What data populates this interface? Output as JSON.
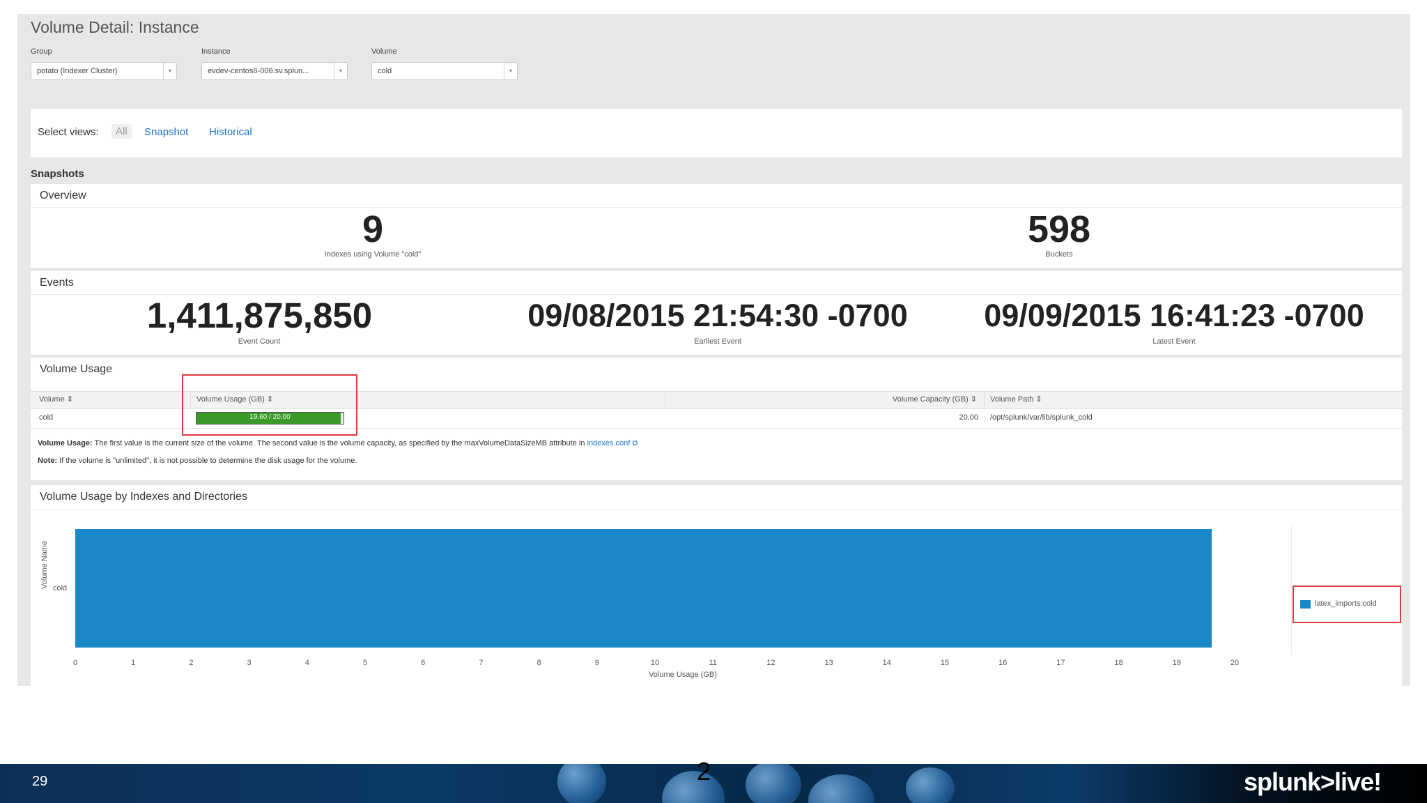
{
  "title": "Volume Detail: Instance",
  "filters": {
    "group": {
      "label": "Group",
      "value": "potato (Indexer Cluster)"
    },
    "instance": {
      "label": "Instance",
      "value": "evdev-centos6-006.sv.splun..."
    },
    "volume": {
      "label": "Volume",
      "value": "cold"
    }
  },
  "views": {
    "label": "Select views:",
    "all": "All",
    "snapshot": "Snapshot",
    "historical": "Historical"
  },
  "snapshots_heading": "Snapshots",
  "overview": {
    "title": "Overview",
    "indexes_value": "9",
    "indexes_label": "Indexes using Volume \"cold\"",
    "buckets_value": "598",
    "buckets_label": "Buckets"
  },
  "events": {
    "title": "Events",
    "count_value": "1,411,875,850",
    "count_label": "Event Count",
    "earliest_value": "09/08/2015 21:54:30 -0700",
    "earliest_label": "Earliest Event",
    "latest_value": "09/09/2015 16:41:23 -0700",
    "latest_label": "Latest Event"
  },
  "volume_usage": {
    "title": "Volume Usage",
    "columns": [
      "Volume",
      "Volume Usage (GB)",
      "Volume Capacity (GB)",
      "Volume Path"
    ],
    "row": {
      "volume": "cold",
      "usage_text": "19.60 / 20.00",
      "usage_fraction": 0.98,
      "capacity": "20.00",
      "path": "/opt/splunk/var/lib/splunk_cold"
    },
    "note1_bold": "Volume Usage:",
    "note1_text": "The first value is the current size of the volume. The second value is the volume capacity, as specified by the maxVolumeDataSizeMB attribute in",
    "note1_link": "indexes.conf",
    "note2_bold": "Note:",
    "note2_text": "If the volume is \"unlimited\", it is not possible to determine the disk usage for the volume."
  },
  "colors": {
    "bar": "#1a87c7",
    "usage_green": "#3b9b2a",
    "highlight": "#e0393e"
  },
  "chart_data": {
    "type": "bar",
    "orientation": "horizontal",
    "title": "Volume Usage by Indexes and Directories",
    "categories": [
      "cold"
    ],
    "series": [
      {
        "name": "latex_imports:cold",
        "values": [
          19.6
        ]
      }
    ],
    "xlabel": "Volume Usage (GB)",
    "ylabel": "Volume Name",
    "xlim": [
      0,
      20
    ],
    "xticks": [
      "0",
      "1",
      "2",
      "3",
      "4",
      "5",
      "6",
      "7",
      "8",
      "9",
      "10",
      "11",
      "12",
      "13",
      "14",
      "15",
      "16",
      "17",
      "18",
      "19",
      "20"
    ],
    "legend_position": "right"
  },
  "footer": {
    "slide_number": "29",
    "center_text": "2",
    "brand": "splunk>live!"
  }
}
